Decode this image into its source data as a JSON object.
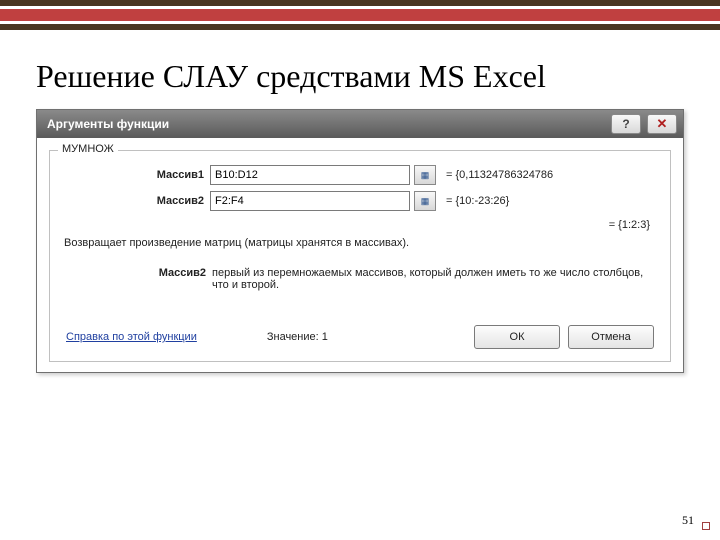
{
  "slide": {
    "title": "Решение СЛАУ средствами MS Excel",
    "page_number": "51"
  },
  "dialog": {
    "title": "Аргументы функции",
    "function_name": "МУМНОЖ",
    "args": [
      {
        "label": "Массив1",
        "value": "B10:D12",
        "result": "= {0,11324786324786"
      },
      {
        "label": "Массив2",
        "value": "F2:F4",
        "result": "= {10:-23:26}"
      }
    ],
    "result_line": "= {1:2:3}",
    "description": "Возвращает произведение матриц (матрицы хранятся в массивах).",
    "arg_help": {
      "label": "Массив2",
      "text": "первый из перемножаемых массивов, который должен иметь то же число столбцов, что и второй."
    },
    "help_link": "Справка по этой функции",
    "value_label": "Значение:",
    "value_value": "1",
    "ok": "ОК",
    "cancel": "Отмена"
  }
}
